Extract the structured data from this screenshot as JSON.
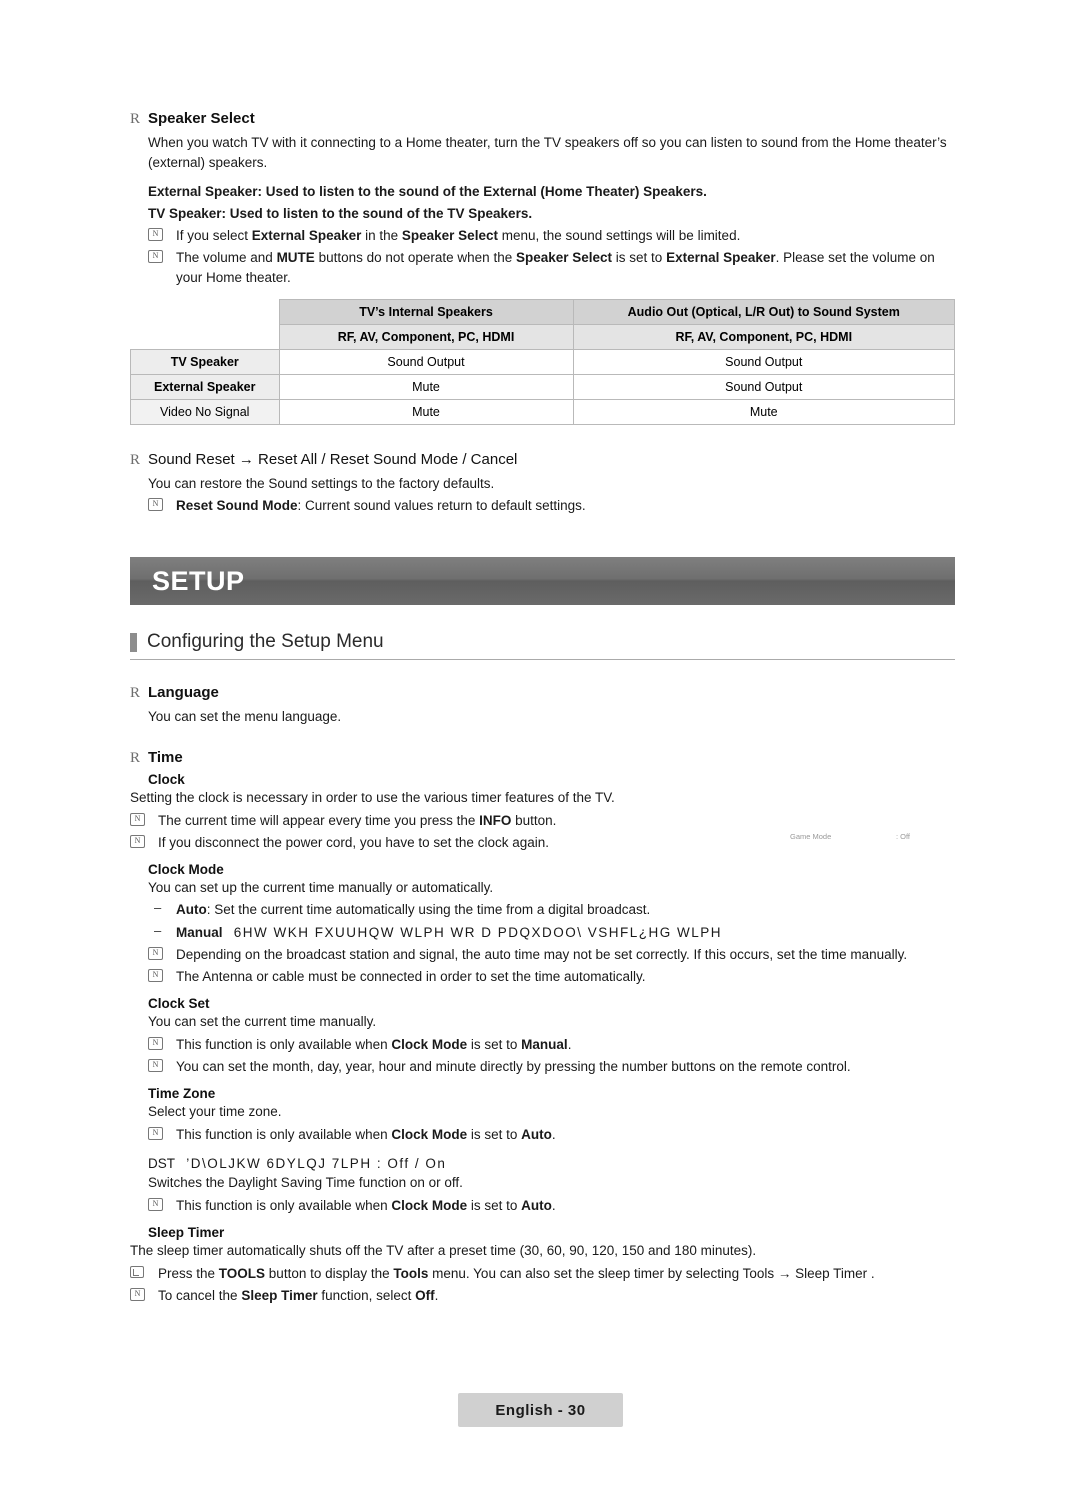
{
  "speaker_select": {
    "heading": "Speaker Select",
    "paragraph": "When you watch TV with it connecting to a Home theater, turn the TV speakers off so you can listen to sound from the Home theater’s (external) speakers.",
    "bold_line_1": "External Speaker: Used to listen to the sound of the External (Home Theater) Speakers.",
    "bold_line_2": "TV Speaker: Used to listen to the sound of the TV Speakers.",
    "note_1_parts": [
      "If you select ",
      "External Speaker",
      " in the ",
      "Speaker Select",
      " menu, the sound settings will be limited."
    ],
    "note_2_parts": [
      "The volume and ",
      "MUTE",
      " buttons do not operate when the ",
      "Speaker Select",
      " is set to ",
      "External Speaker",
      ". Please set the volume on your Home theater."
    ]
  },
  "speaker_table": {
    "header": [
      "",
      "TV’s Internal Speakers",
      "Audio Out (Optical, L/R Out) to Sound System"
    ],
    "subheader": [
      "",
      "RF, AV, Component, PC, HDMI",
      "RF, AV, Component, PC, HDMI"
    ],
    "rows": [
      {
        "label": "TV Speaker",
        "label_bold": true,
        "cells": [
          "Sound Output",
          "Sound Output"
        ]
      },
      {
        "label": "External Speaker",
        "label_bold": true,
        "cells": [
          "Mute",
          "Sound Output"
        ]
      },
      {
        "label": "Video No Signal",
        "label_bold": false,
        "cells": [
          "Mute",
          "Mute"
        ]
      }
    ]
  },
  "sound_reset": {
    "heading": "Sound Reset → Reset  All / Reset Sound Mode / Cancel",
    "paragraph": "You can restore the Sound settings to the factory defaults.",
    "note_parts": [
      "Reset Sound Mode",
      ": Current sound values return to default settings."
    ]
  },
  "banner": {
    "title": "SETUP"
  },
  "section": {
    "title": "Configuring the Setup Menu"
  },
  "language": {
    "heading": "Language",
    "paragraph": "You can set the menu language."
  },
  "time": {
    "heading": "Time",
    "clock_head": "Clock",
    "clock_paragraph": "Setting the clock is necessary in order to use the various timer features of the TV.",
    "clock_note_1_parts": [
      "The current time will appear every time you press the ",
      "INFO",
      " button."
    ],
    "clock_note_2": "If you disconnect the power cord, you have to set the clock again.",
    "clock_mode_head": "Clock Mode",
    "clock_mode_paragraph": "You can set up the current time manually or automatically.",
    "clock_mode_auto_parts": [
      "Auto",
      ": Set the current time automatically using the time from a digital broadcast."
    ],
    "clock_mode_manual_label": "Manual",
    "clock_mode_manual_garbled": "6HW WKH FXUUHQW WLPH WR D PDQXDOO\\ VSHFL¿HG WLPH",
    "clock_mode_note_1": "Depending on the broadcast station and signal, the auto time may not be set correctly. If this occurs, set the time manually.",
    "clock_mode_note_2": "The Antenna or cable must be connected in order to set the time automatically.",
    "clock_set_head": "Clock Set",
    "clock_set_paragraph": "You can set the current time manually.",
    "clock_set_note_1_parts": [
      "This function is only available when ",
      "Clock Mode",
      " is set to ",
      "Manual",
      "."
    ],
    "clock_set_note_2": "You can set the month, day, year, hour and minute directly by pressing the number buttons on the remote control.",
    "time_zone_head": "Time Zone",
    "time_zone_paragraph": "Select your time zone.",
    "time_zone_note_parts": [
      "This function is only available when ",
      "Clock Mode",
      " is set to ",
      "Auto",
      "."
    ],
    "dst_label": "DST",
    "dst_garbled": "’D\\OLJKW 6DYLQJ 7LPH : Off / On",
    "dst_paragraph": "Switches the Daylight Saving Time function on or off.",
    "dst_note_parts": [
      "This function is only available when ",
      "Clock Mode",
      " is set to ",
      "Auto",
      "."
    ],
    "sleep_timer_head": "Sleep Timer",
    "sleep_timer_paragraph": "The sleep timer automatically shuts off the TV after a preset time (30, 60, 90, 120, 150 and 180 minutes).",
    "sleep_timer_tools_parts": [
      "Press the ",
      "TOOLS",
      " button to display the ",
      "Tools",
      " menu. You can also set the sleep timer by selecting Tools → Sleep Timer  ."
    ],
    "sleep_timer_note_parts": [
      "To cancel the ",
      "Sleep Timer",
      " function, select ",
      "Off",
      "."
    ]
  },
  "osd_artifact": {
    "label": "Game Mode",
    "value": ": Off"
  },
  "footer": {
    "label": "English - 30"
  }
}
